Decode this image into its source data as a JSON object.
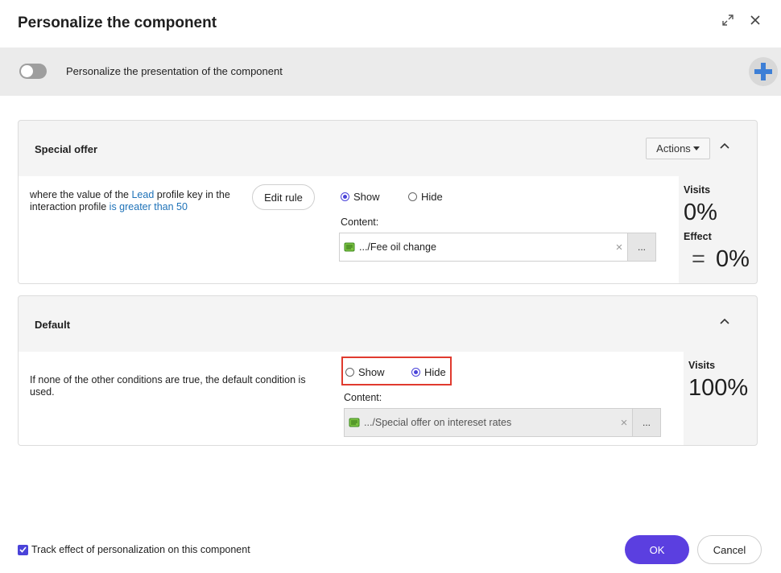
{
  "dialog": {
    "title": "Personalize the component",
    "expand_icon": "expand-icon",
    "close_icon": "close-icon"
  },
  "toolbar": {
    "toggle_label": "Personalize the presentation of the component",
    "toggle_on": false,
    "add_icon": "plus-icon"
  },
  "variants": [
    {
      "title": "Special offer",
      "actions_label": "Actions",
      "rule_parts": [
        "where the value of the ",
        "Lead",
        " profile key in the interaction profile ",
        "is greater than 50"
      ],
      "edit_rule_label": "Edit rule",
      "show_label": "Show",
      "hide_label": "Hide",
      "selected": "Show",
      "content_label": "Content:",
      "content_value": ".../Fee oil change",
      "clear_label": "×",
      "browse_label": "...",
      "visits_label": "Visits",
      "visits_value": "0%",
      "effect_label": "Effect",
      "effect_symbol": "=",
      "effect_value": "0%"
    },
    {
      "title": "Default",
      "rule_text": "If none of the other conditions are true, the default condition is used.",
      "show_label": "Show",
      "hide_label": "Hide",
      "selected": "Hide",
      "content_label": "Content:",
      "content_value": ".../Special offer on intereset rates",
      "clear_label": "×",
      "browse_label": "...",
      "visits_label": "Visits",
      "visits_value": "100%"
    }
  ],
  "footer": {
    "track_label": "Track effect of personalization on this component",
    "track_checked": true,
    "ok_label": "OK",
    "cancel_label": "Cancel"
  },
  "colors": {
    "accent": "#5b3fe0",
    "radio_selected": "#4a43d9",
    "link": "#1e72b8",
    "highlight": "#e03a2e",
    "toolbar_bg": "#ebebeb",
    "add_icon": "#3d7fd6"
  }
}
